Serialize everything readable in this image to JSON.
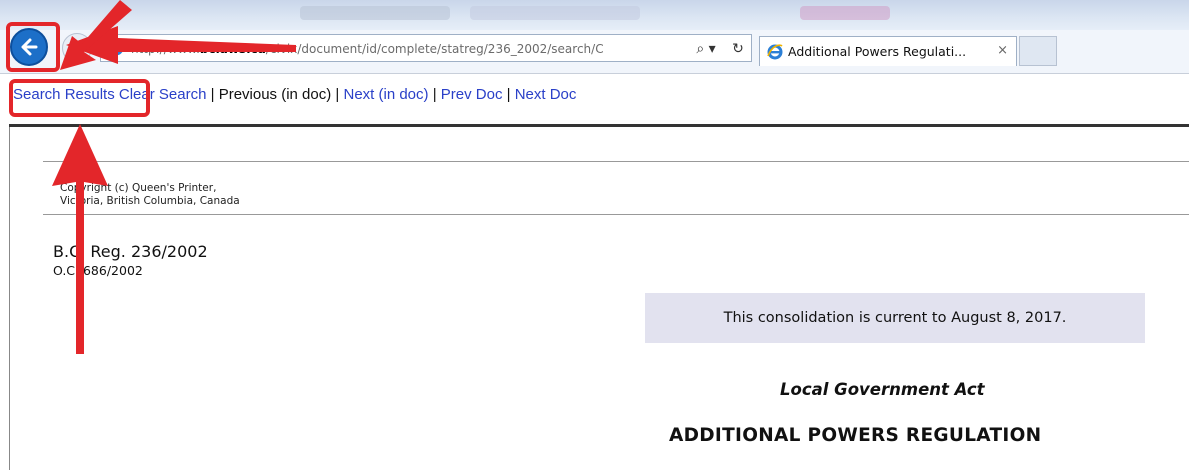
{
  "browser": {
    "address_url_prefix": "http://www.",
    "address_url_domain": "bclaws.ca",
    "address_url_path": "/civix/document/id/complete/statreg/236_2002/search/C",
    "search_dropdown_label": "⌕ ▾",
    "refresh_label": "↻",
    "tab_title": "Additional Powers Regulati...",
    "tab_close_label": "×",
    "icons": {
      "back": "back-arrow-icon",
      "forward": "forward-arrow-icon",
      "site": "ie-logo-icon",
      "search": "search-icon",
      "refresh": "refresh-icon",
      "close": "close-icon"
    }
  },
  "doc_nav": {
    "search_results": "Search Results",
    "clear_search": "Clear Search",
    "separator": "|",
    "previous_in_doc": "Previous (in doc)",
    "next_in_doc": "Next (in doc)",
    "prev_doc": "Prev Doc",
    "next_doc": "Next Doc"
  },
  "document": {
    "copyright_line1": "Copyright (c) Queen's Printer,",
    "copyright_line2": "Victoria, British Columbia, Canada",
    "bc_reg": "B.C. Reg. 236/2002",
    "oc": "O.C. 686/2002",
    "consolidation_note": "This consolidation is current to August 8, 2017.",
    "act_title": "Local Government Act",
    "regulation_title": "ADDITIONAL POWERS REGULATION"
  },
  "colors": {
    "annotation_red": "#e3262a",
    "link_blue": "#2a40c8",
    "back_button_blue": "#1c6fc8",
    "consolidation_bg": "#e2e2ef"
  }
}
